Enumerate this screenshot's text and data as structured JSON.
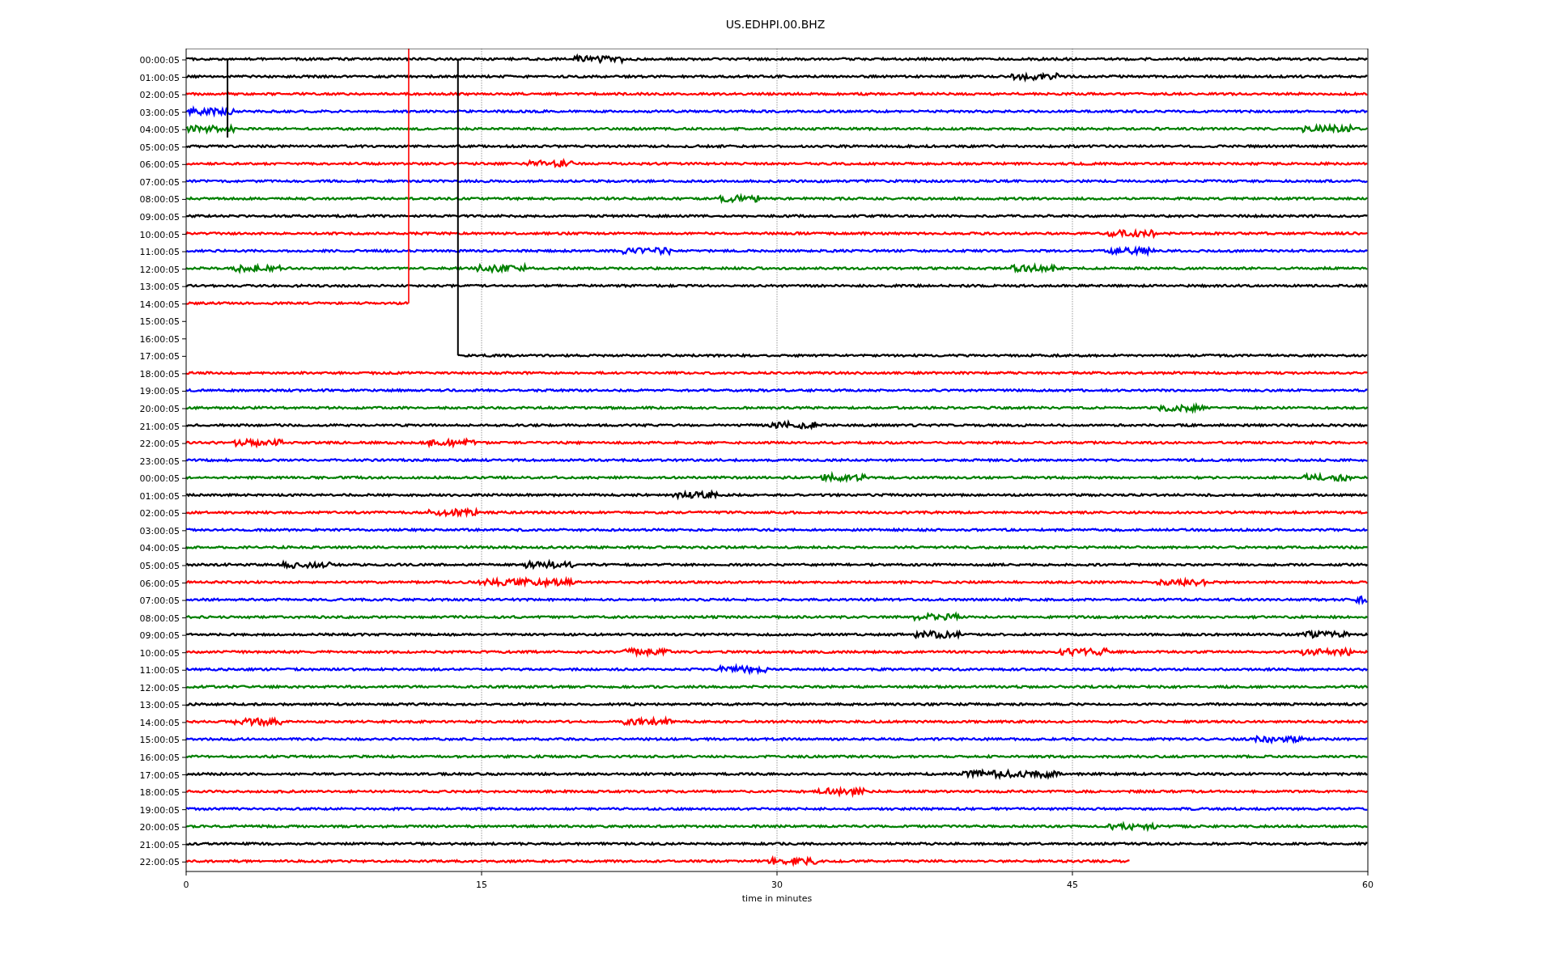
{
  "title": "US.EDHPI.00.BHZ",
  "xlabel": "time in minutes",
  "xticks": [
    "0",
    "15",
    "30",
    "45",
    "60"
  ],
  "rows": [
    {
      "label": "00:00:05",
      "color": "#000000",
      "kind": "full"
    },
    {
      "label": "01:00:05",
      "color": "#000000",
      "kind": "full"
    },
    {
      "label": "02:00:05",
      "color": "#ff0000",
      "kind": "full"
    },
    {
      "label": "03:00:05",
      "color": "#0000ff",
      "kind": "full"
    },
    {
      "label": "04:00:05",
      "color": "#008000",
      "kind": "full"
    },
    {
      "label": "05:00:05",
      "color": "#000000",
      "kind": "full"
    },
    {
      "label": "06:00:05",
      "color": "#ff0000",
      "kind": "full"
    },
    {
      "label": "07:00:05",
      "color": "#0000ff",
      "kind": "full"
    },
    {
      "label": "08:00:05",
      "color": "#008000",
      "kind": "full"
    },
    {
      "label": "09:00:05",
      "color": "#000000",
      "kind": "full"
    },
    {
      "label": "10:00:05",
      "color": "#ff0000",
      "kind": "full"
    },
    {
      "label": "11:00:05",
      "color": "#0000ff",
      "kind": "full"
    },
    {
      "label": "12:00:05",
      "color": "#008000",
      "kind": "full"
    },
    {
      "label": "13:00:05",
      "color": "#000000",
      "kind": "full"
    },
    {
      "label": "14:00:05",
      "color": "#ff0000",
      "kind": "step_end"
    },
    {
      "label": "15:00:05",
      "kind": "none"
    },
    {
      "label": "16:00:05",
      "kind": "none"
    },
    {
      "label": "17:00:05",
      "color": "#000000",
      "kind": "late_start"
    },
    {
      "label": "18:00:05",
      "color": "#ff0000",
      "kind": "full"
    },
    {
      "label": "19:00:05",
      "color": "#0000ff",
      "kind": "full"
    },
    {
      "label": "20:00:05",
      "color": "#008000",
      "kind": "full"
    },
    {
      "label": "21:00:05",
      "color": "#000000",
      "kind": "full"
    },
    {
      "label": "22:00:05",
      "color": "#ff0000",
      "kind": "full"
    },
    {
      "label": "23:00:05",
      "color": "#0000ff",
      "kind": "full"
    },
    {
      "label": "00:00:05",
      "color": "#008000",
      "kind": "full"
    },
    {
      "label": "01:00:05",
      "color": "#000000",
      "kind": "full"
    },
    {
      "label": "02:00:05",
      "color": "#ff0000",
      "kind": "full"
    },
    {
      "label": "03:00:05",
      "color": "#0000ff",
      "kind": "full"
    },
    {
      "label": "04:00:05",
      "color": "#008000",
      "kind": "full"
    },
    {
      "label": "05:00:05",
      "color": "#000000",
      "kind": "full"
    },
    {
      "label": "06:00:05",
      "color": "#ff0000",
      "kind": "full"
    },
    {
      "label": "07:00:05",
      "color": "#0000ff",
      "kind": "full"
    },
    {
      "label": "08:00:05",
      "color": "#008000",
      "kind": "full"
    },
    {
      "label": "09:00:05",
      "color": "#000000",
      "kind": "full"
    },
    {
      "label": "10:00:05",
      "color": "#ff0000",
      "kind": "full"
    },
    {
      "label": "11:00:05",
      "color": "#0000ff",
      "kind": "full"
    },
    {
      "label": "12:00:05",
      "color": "#008000",
      "kind": "full"
    },
    {
      "label": "13:00:05",
      "color": "#000000",
      "kind": "full"
    },
    {
      "label": "14:00:05",
      "color": "#ff0000",
      "kind": "full"
    },
    {
      "label": "15:00:05",
      "color": "#0000ff",
      "kind": "full"
    },
    {
      "label": "16:00:05",
      "color": "#008000",
      "kind": "full"
    },
    {
      "label": "17:00:05",
      "color": "#000000",
      "kind": "full"
    },
    {
      "label": "18:00:05",
      "color": "#ff0000",
      "kind": "full"
    },
    {
      "label": "19:00:05",
      "color": "#0000ff",
      "kind": "full"
    },
    {
      "label": "20:00:05",
      "color": "#008000",
      "kind": "full"
    },
    {
      "label": "21:00:05",
      "color": "#000000",
      "kind": "full"
    },
    {
      "label": "22:00:05",
      "color": "#ff0000",
      "kind": "early_end"
    }
  ]
}
